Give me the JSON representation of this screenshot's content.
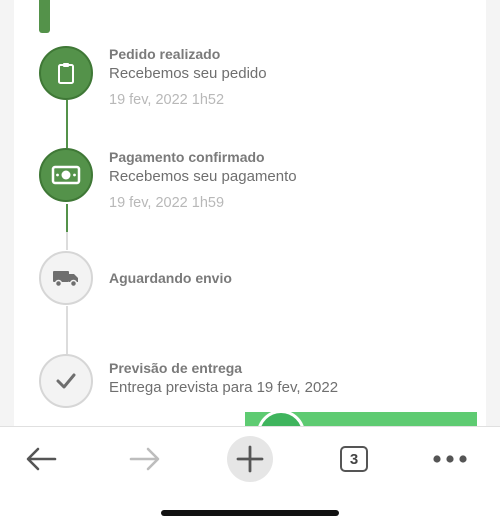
{
  "timeline": {
    "steps": [
      {
        "title": "Pedido realizado",
        "subtitle": "Recebemos seu pedido",
        "date": "19 fev, 2022 1h52",
        "status": "done",
        "icon": "clipboard-icon"
      },
      {
        "title": "Pagamento confirmado",
        "subtitle": "Recebemos seu pagamento",
        "date": "19 fev, 2022 1h59",
        "status": "done",
        "icon": "money-icon"
      },
      {
        "title": "Aguardando envio",
        "subtitle": "",
        "date": "",
        "status": "pending",
        "icon": "truck-icon"
      },
      {
        "title": "Previsão de entrega",
        "subtitle": "Entrega prevista para 19 fev, 2022",
        "date": "",
        "status": "pending",
        "icon": "check-icon"
      }
    ]
  },
  "browser_toolbar": {
    "tab_count": "3",
    "icons": [
      "back-arrow-icon",
      "forward-arrow-icon",
      "plus-icon",
      "tabs-icon",
      "more-icon"
    ]
  },
  "colors": {
    "done_green": "#54924a",
    "pending_gray": "#d6d6d6",
    "cta_green": "#5ecb72"
  }
}
